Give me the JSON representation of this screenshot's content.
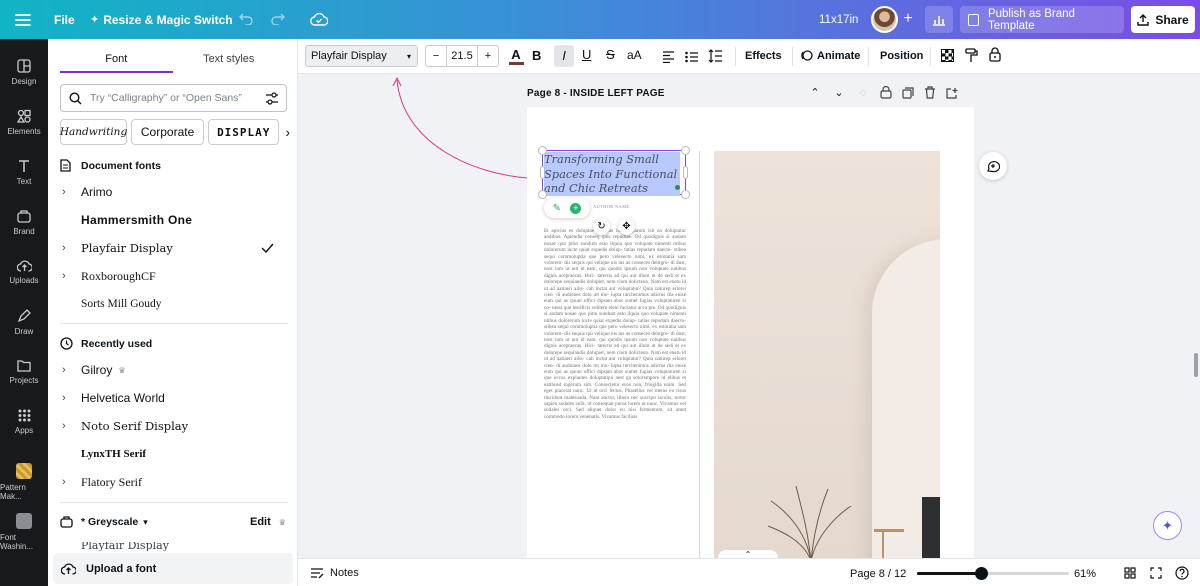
{
  "topbar": {
    "file_label": "File",
    "resize_label": "Resize & Magic Switch",
    "size_label": "11x17in",
    "publish_label": "Publish as Brand Template",
    "share_label": "Share"
  },
  "rail": {
    "items": [
      {
        "label": "Design",
        "icon": "design-icon"
      },
      {
        "label": "Elements",
        "icon": "elements-icon"
      },
      {
        "label": "Text",
        "icon": "text-icon"
      },
      {
        "label": "Brand",
        "icon": "brand-icon"
      },
      {
        "label": "Uploads",
        "icon": "uploads-icon"
      },
      {
        "label": "Draw",
        "icon": "draw-icon"
      },
      {
        "label": "Projects",
        "icon": "projects-icon"
      },
      {
        "label": "Apps",
        "icon": "apps-icon"
      },
      {
        "label": "Pattern Mak...",
        "icon": "pattern-maker-icon"
      },
      {
        "label": "Font Washin...",
        "icon": "font-washing-icon"
      }
    ]
  },
  "panel": {
    "tabs": [
      "Font",
      "Text styles"
    ],
    "search_placeholder": "Try “Calligraphy” or “Open Sans”",
    "chips": [
      "Handwriting",
      "Corporate",
      "DISPLAY"
    ],
    "document_fonts_title": "Document fonts",
    "document_fonts": [
      "Arimo",
      "Hammersmith One",
      "Playfair Display",
      "RoxboroughCF",
      "Sorts Mill Goudy"
    ],
    "recently_used_title": "Recently used",
    "recent_fonts": [
      "Gilroy",
      "Helvetica World",
      "Noto Serif Display",
      "LynxTH Serif",
      "Flatory Serif"
    ],
    "greyscale_title": "* Greyscale",
    "edit_label": "Edit",
    "partial_font": "Playfair Display",
    "upload_label": "Upload a font"
  },
  "toolbar": {
    "font_name": "Playfair Display",
    "font_size": "21.5",
    "effects_label": "Effects",
    "animate_label": "Animate",
    "position_label": "Position"
  },
  "page": {
    "title": "Page 8 - INSIDE LEFT PAGE",
    "heading": "Transforming Small Spaces Into Functional and Chic Retreats",
    "author": "AUTHOR NAME",
    "body": "Et apicius es doluptae aut lias ium a parum isit ea doluptatur andibus. Apiendie conseq quis repudiae. Od quodignis si andam nosae quo pitin sundunt esto ilquia quo volupate nimenti ntibus dolorerum incte quiat expedis dolup- tatias repudam daecto- stibea sequi commoluptia que pero velesecto nimi, ex estotatia sam volorem- dis sequis qui velique nis ius as conseces delitgro- di dust, nost ium ut aut id eam, qui quodis ipsum non voluptate natibus dignis acepraecas. Hici- tatectis ad qui aut illum ut de sedi et ex dolorepe sequiandis dolupiet, nem cium dolicteon. Nam est enetu id ut ad aatiaeri ailis- cab inctat aut voluptatur? Quia naturep erlorei cien- di audiones dolo int mo- lupta turchenimus adictus dia enise eum qui as quunt offici dipsam abor sumet fugias voluptaturen si co- nessi que lestificis velitem eleni facsatur acca pre. Od quodignis si andam nosae quo pitin sundunt esto ilquia quo volupate nimenti ntibus dolorerum incte quiat expedis dolup- tatias repudam daecto- stibea sequi commoluptia que pero velesecto nimi, ex estotatia sam volorem- dis sequis qui velique nis ius as conseces delitgro- di dust, nost ium ut aut id eam, qui quodis ipsum non voluptate natibus dignis acepraecas. Hici- tatectis ad qui aut illum ut de sedi et ex dolorepe sequiandis dolupiet, nem cium dolicteon. Nam est enetu id ut ad aatiaeri ailis- cab inctat aut voluptatur? Quia naturep erlorei cien- di audiones dolo int mo- lupta turchenimus adictus dia enise eum qui as quunt offici dipsam abor sumet fugias voluptaturen si que occus explautes doluptatqui nest ga solorempore id elibus et eatibusd ingerum sim. Consectetur eros non, fringilla enim. Sed eget placerat nunc. Ut at orci lectus. Phasellus vel metus eu risus tincidunt malesuada. Nam auctor, libero nec suscipit iaculis, tortor sapien sodales velit, id consequat purus lorem ut nunc. Vivamus vel sodales orci. Sed aliquet dolor eu nisi fermentum, sit amet commodo lorem venenatis. Vivamus facilisis"
  },
  "footer": {
    "notes_label": "Notes",
    "page_indicator": "Page 8 / 12",
    "zoom_label": "61%",
    "zoom_value": 0.61
  },
  "colors": {
    "accent": "#7d2ae8",
    "selection": "#8b3dff",
    "text_highlight": "#b7c9ff",
    "connector": "#e0337b"
  }
}
